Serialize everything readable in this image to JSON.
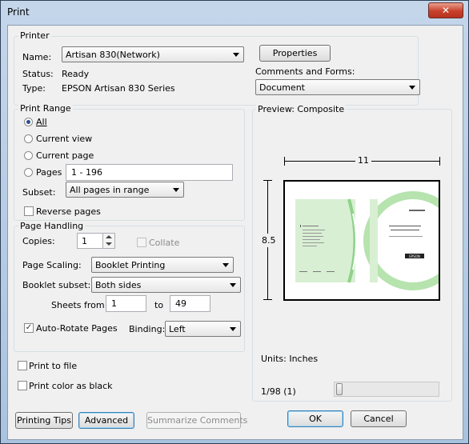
{
  "window": {
    "title": "Print",
    "close_glyph": "✕"
  },
  "printer": {
    "group_label": "Printer",
    "name_label": "Name:",
    "name_value": "Artisan 830(Network)",
    "status_label": "Status:",
    "status_value": "Ready",
    "type_label": "Type:",
    "type_value": "EPSON Artisan 830 Series",
    "properties_button": "Properties",
    "comments_label": "Comments and Forms:",
    "comments_value": "Document"
  },
  "print_range": {
    "group_label": "Print Range",
    "all": "All",
    "current_view": "Current view",
    "current_page": "Current page",
    "pages": "Pages",
    "pages_value": "1 - 196",
    "subset_label": "Subset:",
    "subset_value": "All pages in range",
    "reverse_pages": "Reverse pages",
    "selected": "all"
  },
  "page_handling": {
    "group_label": "Page Handling",
    "copies_label": "Copies:",
    "copies_value": "1",
    "collate": "Collate",
    "scaling_label": "Page Scaling:",
    "scaling_value": "Booklet Printing",
    "booklet_label": "Booklet subset:",
    "booklet_value": "Both sides",
    "sheets_from_label": "Sheets from",
    "sheets_from_value": "1",
    "to_label": "to",
    "to_value": "49",
    "auto_rotate": "Auto-Rotate Pages",
    "auto_rotate_checked": true,
    "binding_label": "Binding:",
    "binding_value": "Left"
  },
  "options": {
    "print_to_file": "Print to file",
    "print_color_black": "Print color as black"
  },
  "preview": {
    "group_label": "Preview: Composite",
    "width_dim": "11",
    "height_dim": "8.5",
    "units": "Units: Inches",
    "page_indicator": "1/98 (1)",
    "cover_brand": "EPSON"
  },
  "buttons": {
    "printing_tips": "Printing Tips",
    "advanced": "Advanced",
    "summarize": "Summarize Comments",
    "ok": "OK",
    "cancel": "Cancel"
  },
  "colors": {
    "accent_green": "#8fd18a",
    "radio_dot": "#2a4e8a"
  },
  "icons": {
    "dropdown": "chevron-down-icon",
    "close": "close-icon"
  }
}
